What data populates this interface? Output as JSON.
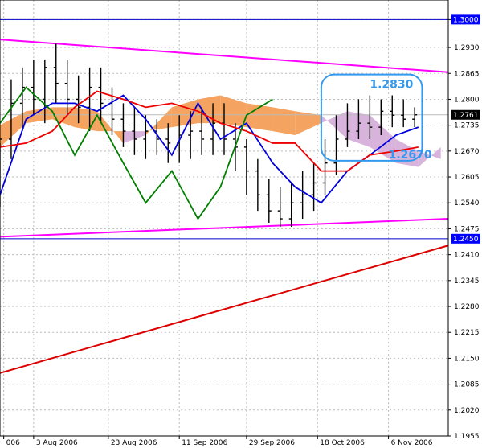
{
  "chart_data": {
    "type": "line",
    "title": "",
    "xlabel": "",
    "ylabel": "",
    "ylim": [
      1.1955,
      1.3025
    ],
    "x_range": [
      "2006-07-25",
      "2006-11-22"
    ],
    "grid": true,
    "y_ticks": [
      "1.3000",
      "1.2930",
      "1.2865",
      "1.2800",
      "1.2735",
      "1.2670",
      "1.2605",
      "1.2540",
      "1.2475",
      "1.2410",
      "1.2345",
      "1.2280",
      "1.2215",
      "1.2150",
      "1.2085",
      "1.2020",
      "1.1955"
    ],
    "x_ticks": [
      {
        "label": "006",
        "date": "2006-07-26"
      },
      {
        "label": "3 Aug 2006",
        "date": "2006-08-03"
      },
      {
        "label": "23 Aug 2006",
        "date": "2006-08-23"
      },
      {
        "label": "11 Sep 2006",
        "date": "2006-09-11"
      },
      {
        "label": "29 Sep 2006",
        "date": "2006-09-29"
      },
      {
        "label": "18 Oct 2006",
        "date": "2006-10-18"
      },
      {
        "label": "6 Nov 2006",
        "date": "2006-11-06"
      }
    ],
    "price_labels": [
      {
        "text": "1.3000",
        "value": 1.3,
        "color": "#0000ff"
      },
      {
        "text": "1.2761",
        "value": 1.2761,
        "color": "#000000"
      },
      {
        "text": "1.2450",
        "value": 1.245,
        "color": "#0000ff"
      }
    ],
    "horizontal_lines": [
      {
        "value": 1.3,
        "color": "#0000cc"
      },
      {
        "value": 1.245,
        "color": "#0000cc"
      },
      {
        "value": 1.2761,
        "color": "#bbbbbb"
      }
    ],
    "trendlines": [
      {
        "name": "upper",
        "color": "#ff00ff",
        "points": [
          [
            "2006-07-25",
            1.295
          ],
          [
            "2006-11-22",
            1.2868
          ]
        ]
      },
      {
        "name": "lower",
        "color": "#ff00ff",
        "points": [
          [
            "2006-07-25",
            1.2455
          ],
          [
            "2006-11-22",
            1.25
          ]
        ]
      },
      {
        "name": "support",
        "color": "#dd0000",
        "points": [
          [
            "2006-07-25",
            1.2113
          ],
          [
            "2006-11-22",
            1.2433
          ]
        ]
      }
    ],
    "annotations": [
      {
        "text": "1.2830",
        "color": "#3399ee",
        "date": "2006-11-01",
        "value": 1.2838
      },
      {
        "text": "1.2670",
        "color": "#3399ee",
        "date": "2006-11-06",
        "value": 1.2662
      }
    ],
    "highlight_box": {
      "from": "2006-10-19",
      "to": "2006-11-15",
      "low": 1.267,
      "high": 1.283,
      "color": "#3399ee"
    },
    "cloud": {
      "up_color": "#f4a460",
      "down_color": "#d8b4dc",
      "dates": [
        "2006-07-25",
        "2006-08-01",
        "2006-08-08",
        "2006-08-14",
        "2006-08-20",
        "2006-08-27",
        "2006-09-02",
        "2006-09-09",
        "2006-09-16",
        "2006-09-22",
        "2006-09-29",
        "2006-10-06",
        "2006-10-12",
        "2006-10-19",
        "2006-10-26",
        "2006-11-01",
        "2006-11-08",
        "2006-11-14",
        "2006-11-20"
      ],
      "span_a": [
        1.2735,
        1.277,
        1.278,
        1.278,
        1.277,
        1.269,
        1.271,
        1.278,
        1.28,
        1.281,
        1.279,
        1.278,
        1.277,
        1.276,
        1.27,
        1.268,
        1.264,
        1.263,
        1.268
      ],
      "span_b": [
        1.268,
        1.274,
        1.275,
        1.273,
        1.272,
        1.272,
        1.272,
        1.273,
        1.274,
        1.274,
        1.273,
        1.272,
        1.271,
        1.274,
        1.277,
        1.276,
        1.27,
        1.267,
        1.265
      ]
    },
    "series": [
      {
        "name": "",
        "color": "#0000dd",
        "x": [
          "2006-07-25",
          "2006-08-01",
          "2006-08-08",
          "2006-08-14",
          "2006-08-20",
          "2006-08-27",
          "2006-09-02",
          "2006-09-09",
          "2006-09-16",
          "2006-09-22",
          "2006-09-29",
          "2006-10-06",
          "2006-10-12",
          "2006-10-19",
          "2006-10-26",
          "2006-11-01",
          "2006-11-08",
          "2006-11-14"
        ],
        "y": [
          1.256,
          1.275,
          1.279,
          1.279,
          1.277,
          1.281,
          1.275,
          1.266,
          1.279,
          1.27,
          1.274,
          1.264,
          1.258,
          1.254,
          1.262,
          1.266,
          1.271,
          1.273
        ]
      },
      {
        "name": "",
        "color": "#ee0000",
        "x": [
          "2006-07-25",
          "2006-08-01",
          "2006-08-08",
          "2006-08-14",
          "2006-08-20",
          "2006-08-27",
          "2006-09-02",
          "2006-09-09",
          "2006-09-16",
          "2006-09-22",
          "2006-09-29",
          "2006-10-06",
          "2006-10-12",
          "2006-10-19",
          "2006-10-26",
          "2006-11-01",
          "2006-11-08",
          "2006-11-14"
        ],
        "y": [
          1.268,
          1.269,
          1.272,
          1.278,
          1.282,
          1.28,
          1.278,
          1.279,
          1.277,
          1.274,
          1.272,
          1.269,
          1.269,
          1.262,
          1.262,
          1.266,
          1.267,
          1.268
        ]
      },
      {
        "name": "",
        "color": "#008000",
        "x": [
          "2006-07-25",
          "2006-08-01",
          "2006-08-08",
          "2006-08-14",
          "2006-08-20",
          "2006-08-27",
          "2006-09-02",
          "2006-09-09",
          "2006-09-16",
          "2006-09-22",
          "2006-09-29",
          "2006-10-06"
        ],
        "y": [
          1.274,
          1.283,
          1.277,
          1.266,
          1.276,
          1.264,
          1.254,
          1.262,
          1.25,
          1.258,
          1.276,
          1.28
        ]
      }
    ],
    "candles": {
      "color": "#000000",
      "dates": [
        "2006-07-25",
        "2006-07-28",
        "2006-07-31",
        "2006-08-03",
        "2006-08-06",
        "2006-08-09",
        "2006-08-12",
        "2006-08-15",
        "2006-08-18",
        "2006-08-21",
        "2006-08-24",
        "2006-08-27",
        "2006-08-30",
        "2006-09-02",
        "2006-09-05",
        "2006-09-08",
        "2006-09-11",
        "2006-09-14",
        "2006-09-17",
        "2006-09-20",
        "2006-09-23",
        "2006-09-26",
        "2006-09-29",
        "2006-10-02",
        "2006-10-05",
        "2006-10-08",
        "2006-10-11",
        "2006-10-14",
        "2006-10-17",
        "2006-10-20",
        "2006-10-23",
        "2006-10-26",
        "2006-10-29",
        "2006-11-01",
        "2006-11-04",
        "2006-11-07",
        "2006-11-10",
        "2006-11-13"
      ],
      "open": [
        1.256,
        1.27,
        1.279,
        1.283,
        1.28,
        1.288,
        1.284,
        1.28,
        1.278,
        1.283,
        1.279,
        1.275,
        1.272,
        1.27,
        1.272,
        1.27,
        1.269,
        1.271,
        1.272,
        1.27,
        1.274,
        1.27,
        1.268,
        1.262,
        1.256,
        1.252,
        1.25,
        1.254,
        1.256,
        1.259,
        1.264,
        1.27,
        1.272,
        1.274,
        1.273,
        1.277,
        1.276,
        1.275
      ],
      "high": [
        1.269,
        1.285,
        1.288,
        1.29,
        1.29,
        1.294,
        1.29,
        1.286,
        1.288,
        1.288,
        1.283,
        1.279,
        1.278,
        1.276,
        1.275,
        1.274,
        1.276,
        1.277,
        1.278,
        1.279,
        1.279,
        1.274,
        1.27,
        1.265,
        1.26,
        1.258,
        1.259,
        1.262,
        1.264,
        1.27,
        1.276,
        1.279,
        1.28,
        1.281,
        1.28,
        1.281,
        1.28,
        1.278
      ],
      "low": [
        1.253,
        1.265,
        1.272,
        1.276,
        1.274,
        1.279,
        1.276,
        1.274,
        1.272,
        1.274,
        1.271,
        1.268,
        1.266,
        1.265,
        1.266,
        1.264,
        1.264,
        1.265,
        1.266,
        1.266,
        1.266,
        1.262,
        1.256,
        1.252,
        1.249,
        1.248,
        1.248,
        1.25,
        1.252,
        1.256,
        1.261,
        1.268,
        1.27,
        1.27,
        1.271,
        1.273,
        1.273,
        1.273
      ],
      "close": [
        1.27,
        1.279,
        1.283,
        1.28,
        1.288,
        1.284,
        1.28,
        1.278,
        1.283,
        1.279,
        1.275,
        1.272,
        1.27,
        1.272,
        1.27,
        1.269,
        1.271,
        1.272,
        1.27,
        1.274,
        1.27,
        1.268,
        1.262,
        1.256,
        1.252,
        1.25,
        1.254,
        1.256,
        1.259,
        1.264,
        1.27,
        1.272,
        1.274,
        1.273,
        1.277,
        1.276,
        1.275,
        1.2761
      ]
    }
  }
}
